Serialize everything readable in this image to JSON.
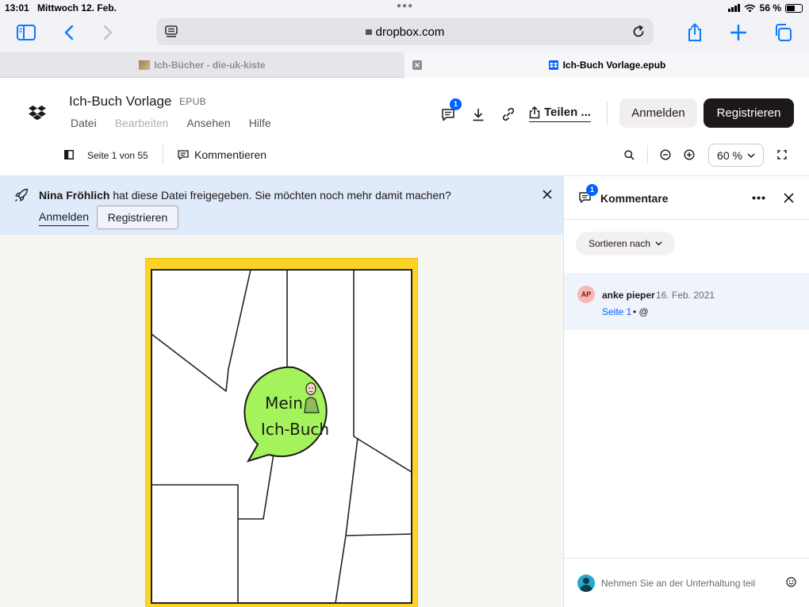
{
  "status": {
    "time": "13:01",
    "date": "Mittwoch 12. Feb.",
    "battery": "56 %",
    "battery_level": 0.56
  },
  "browser": {
    "url": "dropbox.com"
  },
  "tabs": [
    {
      "label": "Ich-Bücher - die-uk-kiste",
      "active": false
    },
    {
      "label": "Ich-Buch Vorlage.epub",
      "active": true
    }
  ],
  "file": {
    "title": "Ich-Buch Vorlage",
    "type": "EPUB"
  },
  "menu": {
    "datei": "Datei",
    "bearbeiten": "Bearbeiten",
    "ansehen": "Ansehen",
    "hilfe": "Hilfe"
  },
  "header": {
    "comment_count": "1",
    "share_label": "Teilen ...",
    "login_label": "Anmelden",
    "register_label": "Registrieren"
  },
  "viewer_toolbar": {
    "page_info": "Seite 1 von 55",
    "comment_label": "Kommentieren",
    "zoom": "60 %"
  },
  "notice": {
    "name": "Nina Fröhlich",
    "text": " hat diese Datei freigegeben. Sie möchten noch mehr damit machen?",
    "login_label": "Anmelden",
    "register_label": "Registrieren"
  },
  "page": {
    "bubble_line1": "Mein",
    "bubble_line2": "Ich-Buch"
  },
  "comments_panel": {
    "title": "Kommentare",
    "count": "1",
    "sort_label": "Sortieren nach",
    "items": [
      {
        "initials": "AP",
        "author": "anke pieper",
        "date": "16. Feb. 2021",
        "page": "Seite 1",
        "rest": "• @"
      }
    ],
    "input_placeholder": "Nehmen Sie an der Unterhaltung teil"
  },
  "colors": {
    "accent": "#0061fe",
    "page_border": "#fcd326",
    "bubble": "#a4f35c"
  }
}
